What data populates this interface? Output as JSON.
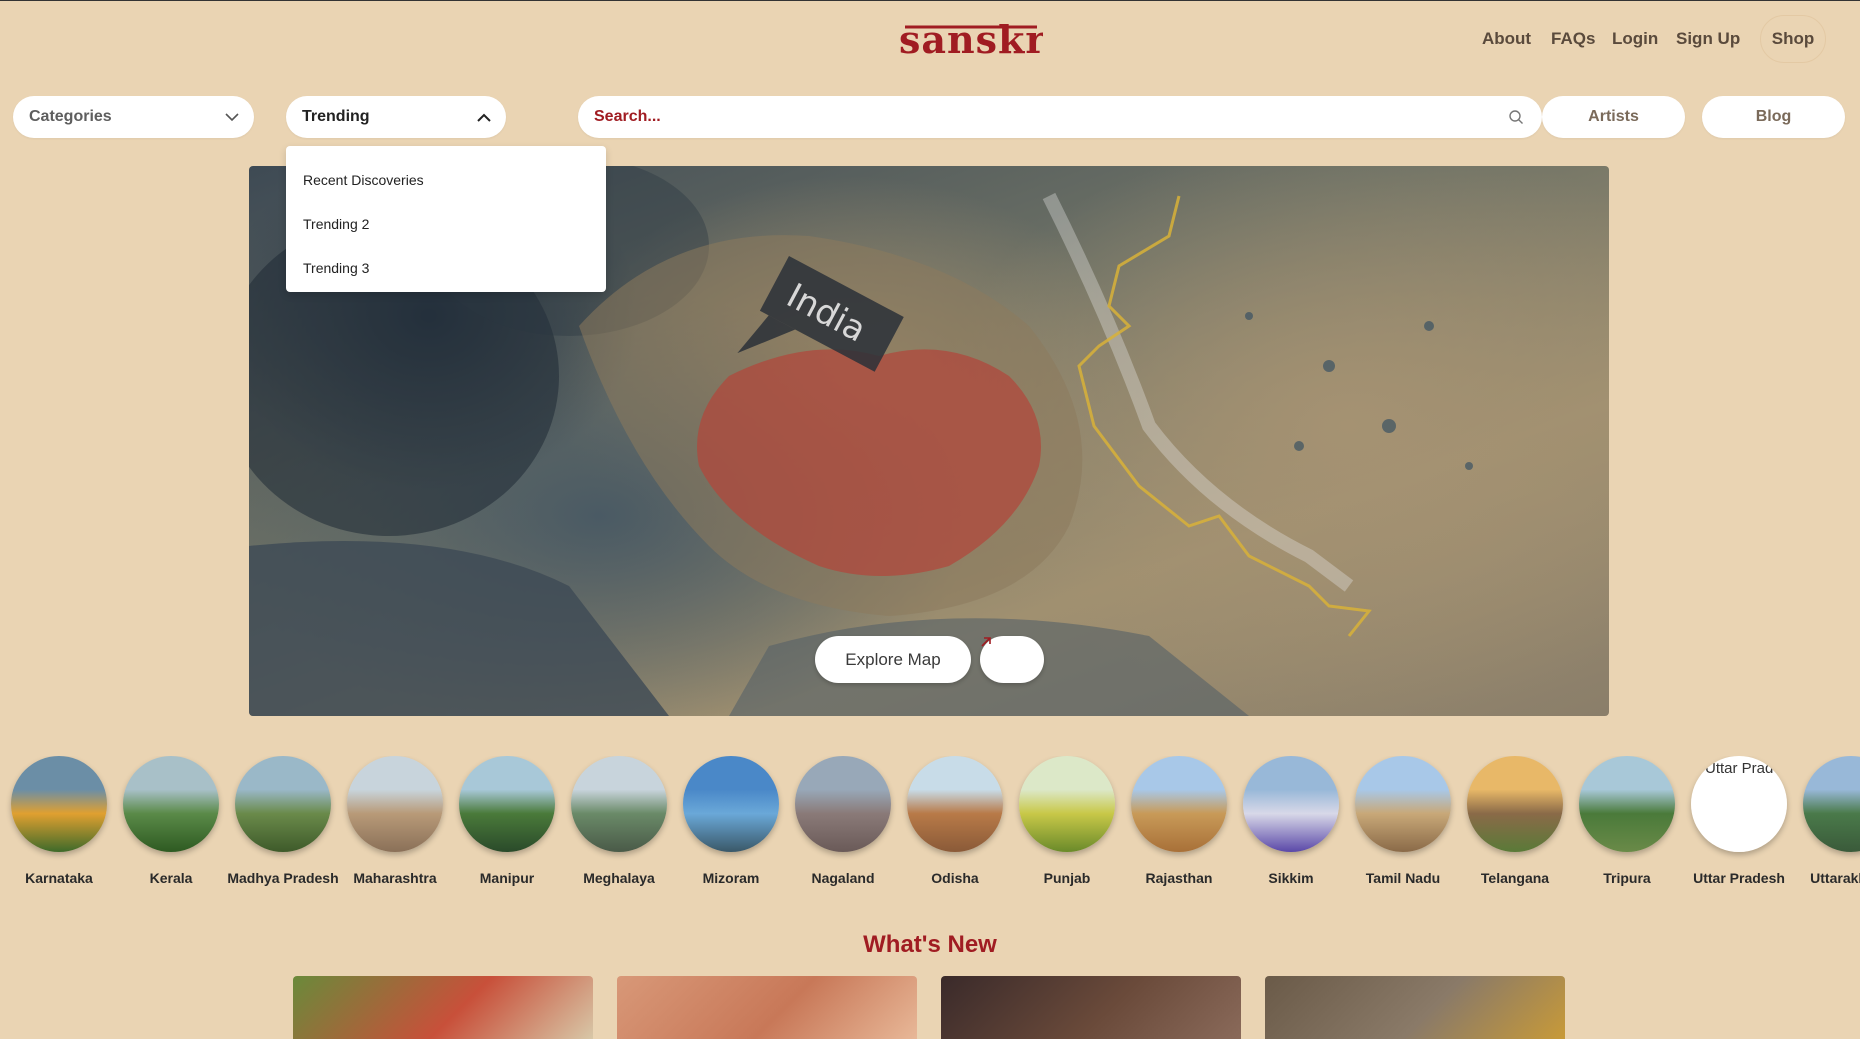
{
  "header": {
    "logo_text": "sanskriti",
    "nav": [
      "About",
      "FAQs",
      "Login",
      "Sign Up"
    ],
    "shop_label": "Shop"
  },
  "toolbar": {
    "categories_label": "Categories",
    "trending_label": "Trending",
    "search_placeholder": "Search...",
    "artists_label": "Artists",
    "blog_label": "Blog"
  },
  "trending_menu": {
    "items": [
      "Recent Discoveries",
      "Trending 2",
      "Trending 3"
    ]
  },
  "hero": {
    "map_label": "India",
    "explore_label": "Explore Map",
    "arrow_icon": "arrow-up-right-icon"
  },
  "states": [
    {
      "name": "Karnataka",
      "colors": [
        "#6b8ea6",
        "#e0a030",
        "#3e6a2a"
      ]
    },
    {
      "name": "Kerala",
      "colors": [
        "#a8c0c8",
        "#5a8a48",
        "#2e5a22"
      ]
    },
    {
      "name": "Madhya Pradesh",
      "colors": [
        "#9ab8c8",
        "#6a8a4a",
        "#3e5a2a"
      ]
    },
    {
      "name": "Maharashtra",
      "colors": [
        "#c8d4dc",
        "#b89a78",
        "#8a7058"
      ]
    },
    {
      "name": "Manipur",
      "colors": [
        "#a8c8d8",
        "#4a7a3a",
        "#2a4a2a"
      ]
    },
    {
      "name": "Meghalaya",
      "colors": [
        "#c8d4dc",
        "#6a8a68",
        "#4a5a48"
      ]
    },
    {
      "name": "Mizoram",
      "colors": [
        "#4a88c8",
        "#6aa8d8",
        "#3a5868"
      ]
    },
    {
      "name": "Nagaland",
      "colors": [
        "#98a8b8",
        "#8a7a78",
        "#6a5a58"
      ]
    },
    {
      "name": "Odisha",
      "colors": [
        "#c8dce8",
        "#b87a48",
        "#8a5a38"
      ]
    },
    {
      "name": "Punjab",
      "colors": [
        "#dce8c8",
        "#c8c848",
        "#6a8a2a"
      ]
    },
    {
      "name": "Rajasthan",
      "colors": [
        "#a8c8e8",
        "#c89a58",
        "#a87038"
      ]
    },
    {
      "name": "Sikkim",
      "colors": [
        "#98b8d8",
        "#d8d8e8",
        "#5a48a8"
      ]
    },
    {
      "name": "Tamil Nadu",
      "colors": [
        "#a8c8e8",
        "#c8a878",
        "#8a6a48"
      ]
    },
    {
      "name": "Telangana",
      "colors": [
        "#e8b868",
        "#8a6a48",
        "#5a7a38"
      ]
    },
    {
      "name": "Tripura",
      "colors": [
        "#a8c8d8",
        "#4a7a3a",
        "#6a8a48"
      ]
    },
    {
      "name": "Uttar Pradesh",
      "colors": [
        "#ffffff",
        "#ffffff",
        "#ffffff"
      ],
      "circle_text": "Uttar Prad"
    },
    {
      "name": "Uttarakhand",
      "colors": [
        "#98b8d8",
        "#4a7a4a",
        "#3a5a3a"
      ]
    }
  ],
  "whats_new": {
    "title": "What's New",
    "cards": [
      {
        "colors": [
          "#6a8a3a",
          "#c8503a",
          "#d8c8a8"
        ]
      },
      {
        "colors": [
          "#d89878",
          "#c87858",
          "#e8b898"
        ]
      },
      {
        "colors": [
          "#3a2a2a",
          "#6a4a3a",
          "#8a6a5a"
        ]
      },
      {
        "colors": [
          "#6a5a48",
          "#8a7a68",
          "#c89a38"
        ]
      }
    ]
  }
}
